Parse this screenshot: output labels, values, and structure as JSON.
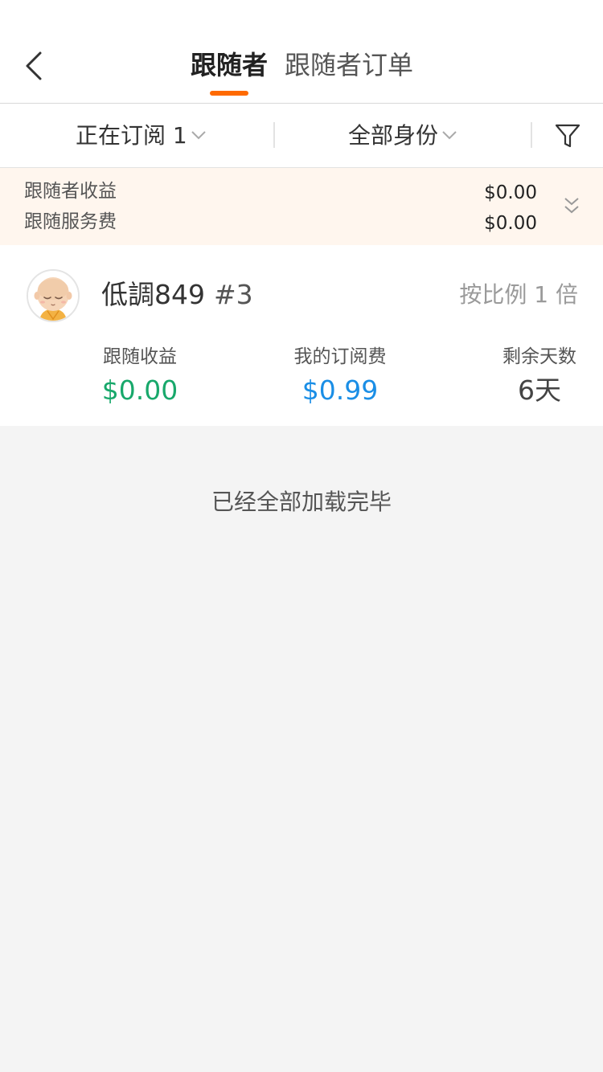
{
  "header": {
    "tabs": [
      {
        "label": "跟随者",
        "active": true
      },
      {
        "label": "跟随者订单",
        "active": false
      }
    ],
    "accent_color": "#ff6a00"
  },
  "filters": {
    "subscription": {
      "label": "正在订阅",
      "count": "1"
    },
    "role": {
      "label": "全部身份"
    },
    "filter_icon": "funnel-icon"
  },
  "summary": {
    "rows": [
      {
        "label": "跟随者收益",
        "value": "$0.00"
      },
      {
        "label": "跟随服务费",
        "value": "$0.00"
      }
    ]
  },
  "follower": {
    "name": "低調849",
    "rank": "#3",
    "ratio": "按比例 1 倍",
    "stats": [
      {
        "label": "跟随收益",
        "value": "$0.00",
        "color": "#18a86b"
      },
      {
        "label": "我的订阅费",
        "value": "$0.99",
        "color": "#1a8ee6"
      },
      {
        "label": "剩余天数",
        "value": "6天",
        "color": "#444444"
      }
    ]
  },
  "footer": {
    "loaded_text": "已经全部加载完毕"
  }
}
